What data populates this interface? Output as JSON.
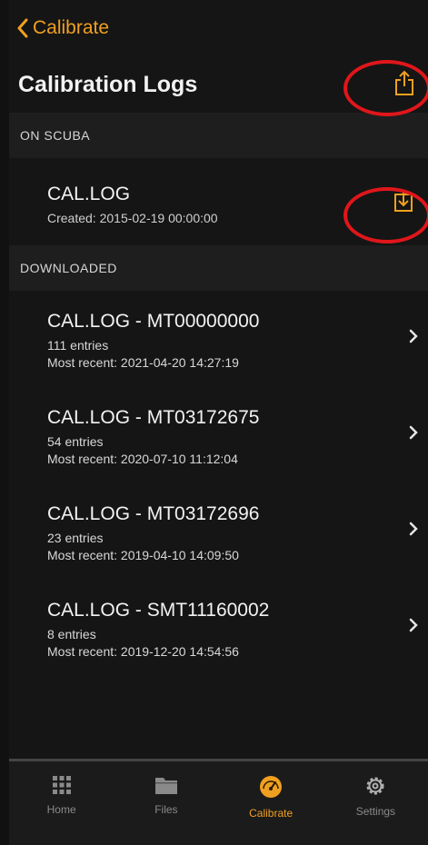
{
  "nav": {
    "back_label": "Calibrate"
  },
  "header": {
    "title": "Calibration Logs"
  },
  "sections": {
    "on_scuba": "ON SCUBA",
    "downloaded": "DOWNLOADED"
  },
  "scuba_log": {
    "name": "CAL.LOG",
    "created": "Created: 2015-02-19 00:00:00"
  },
  "logs": [
    {
      "name": "CAL.LOG - MT00000000",
      "entries": "111 entries",
      "recent": "Most recent: 2021-04-20 14:27:19"
    },
    {
      "name": "CAL.LOG - MT03172675",
      "entries": "54 entries",
      "recent": "Most recent: 2020-07-10 11:12:04"
    },
    {
      "name": "CAL.LOG - MT03172696",
      "entries": "23 entries",
      "recent": "Most recent: 2019-04-10 14:09:50"
    },
    {
      "name": "CAL.LOG - SMT11160002",
      "entries": "8 entries",
      "recent": "Most recent: 2019-12-20 14:54:56"
    }
  ],
  "tabs": [
    {
      "label": "Home",
      "icon": "grid-icon"
    },
    {
      "label": "Files",
      "icon": "folder-icon"
    },
    {
      "label": "Calibrate",
      "icon": "gauge-icon",
      "active": true
    },
    {
      "label": "Settings",
      "icon": "gear-icon"
    }
  ],
  "colors": {
    "accent": "#f0a020",
    "highlight_ring": "#e0161b",
    "background": "#151515"
  }
}
